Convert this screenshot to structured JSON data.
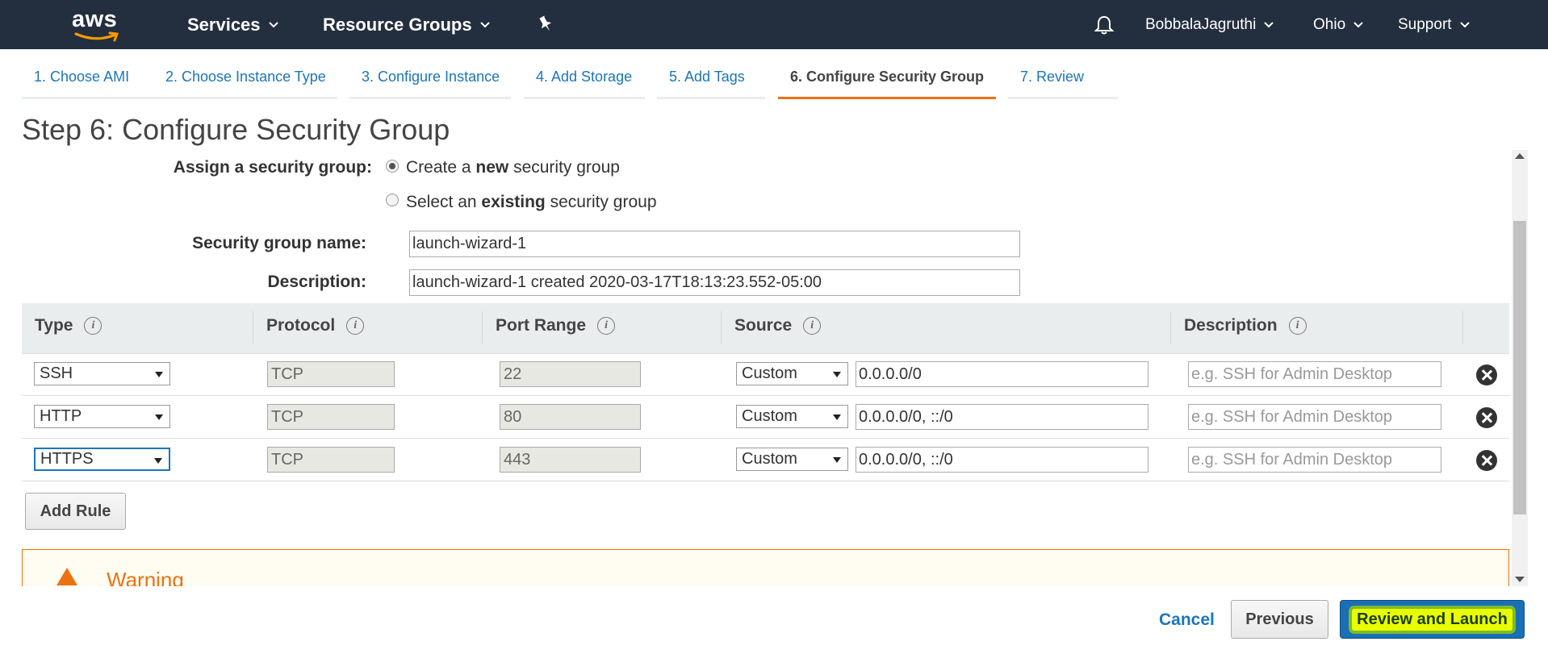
{
  "nav": {
    "services": "Services",
    "resource_groups": "Resource Groups",
    "user": "BobbalaJagruthi",
    "region": "Ohio",
    "support": "Support",
    "logo_text": "aws"
  },
  "tabs": [
    {
      "label": "1. Choose AMI"
    },
    {
      "label": "2. Choose Instance Type"
    },
    {
      "label": "3. Configure Instance"
    },
    {
      "label": "4. Add Storage"
    },
    {
      "label": "5. Add Tags"
    },
    {
      "label": "6. Configure Security Group",
      "active": true
    },
    {
      "label": "7. Review"
    }
  ],
  "step_title": "Step 6: Configure Security Group",
  "assign": {
    "label": "Assign a security group:",
    "option_new_prefix": "Create a ",
    "option_new_bold": "new",
    "option_new_suffix": " security group",
    "option_existing_prefix": "Select an ",
    "option_existing_bold": "existing",
    "option_existing_suffix": " security group",
    "selected": "new"
  },
  "sg_name": {
    "label": "Security group name:",
    "value": "launch-wizard-1"
  },
  "description": {
    "label": "Description:",
    "value": "launch-wizard-1 created 2020-03-17T18:13:23.552-05:00"
  },
  "table": {
    "headers": [
      "Type",
      "Protocol",
      "Port Range",
      "Source",
      "Description"
    ],
    "rows": [
      {
        "type": "SSH",
        "protocol": "TCP",
        "port": "22",
        "source_type": "Custom",
        "source": "0.0.0.0/0",
        "desc_placeholder": "e.g. SSH for Admin Desktop"
      },
      {
        "type": "HTTP",
        "protocol": "TCP",
        "port": "80",
        "source_type": "Custom",
        "source": "0.0.0.0/0, ::/0",
        "desc_placeholder": "e.g. SSH for Admin Desktop"
      },
      {
        "type": "HTTPS",
        "protocol": "TCP",
        "port": "443",
        "source_type": "Custom",
        "source": "0.0.0.0/0, ::/0",
        "desc_placeholder": "e.g. SSH for Admin Desktop"
      }
    ]
  },
  "add_rule": "Add Rule",
  "warning": {
    "title": "Warning"
  },
  "footer": {
    "cancel": "Cancel",
    "previous": "Previous",
    "review": "Review and Launch"
  },
  "colors": {
    "nav_bg": "#232f3e",
    "accent_orange": "#ec7211",
    "link_blue": "#1b75bb",
    "primary_btn": "#1a6fb6",
    "highlight": "#e8ff00"
  }
}
